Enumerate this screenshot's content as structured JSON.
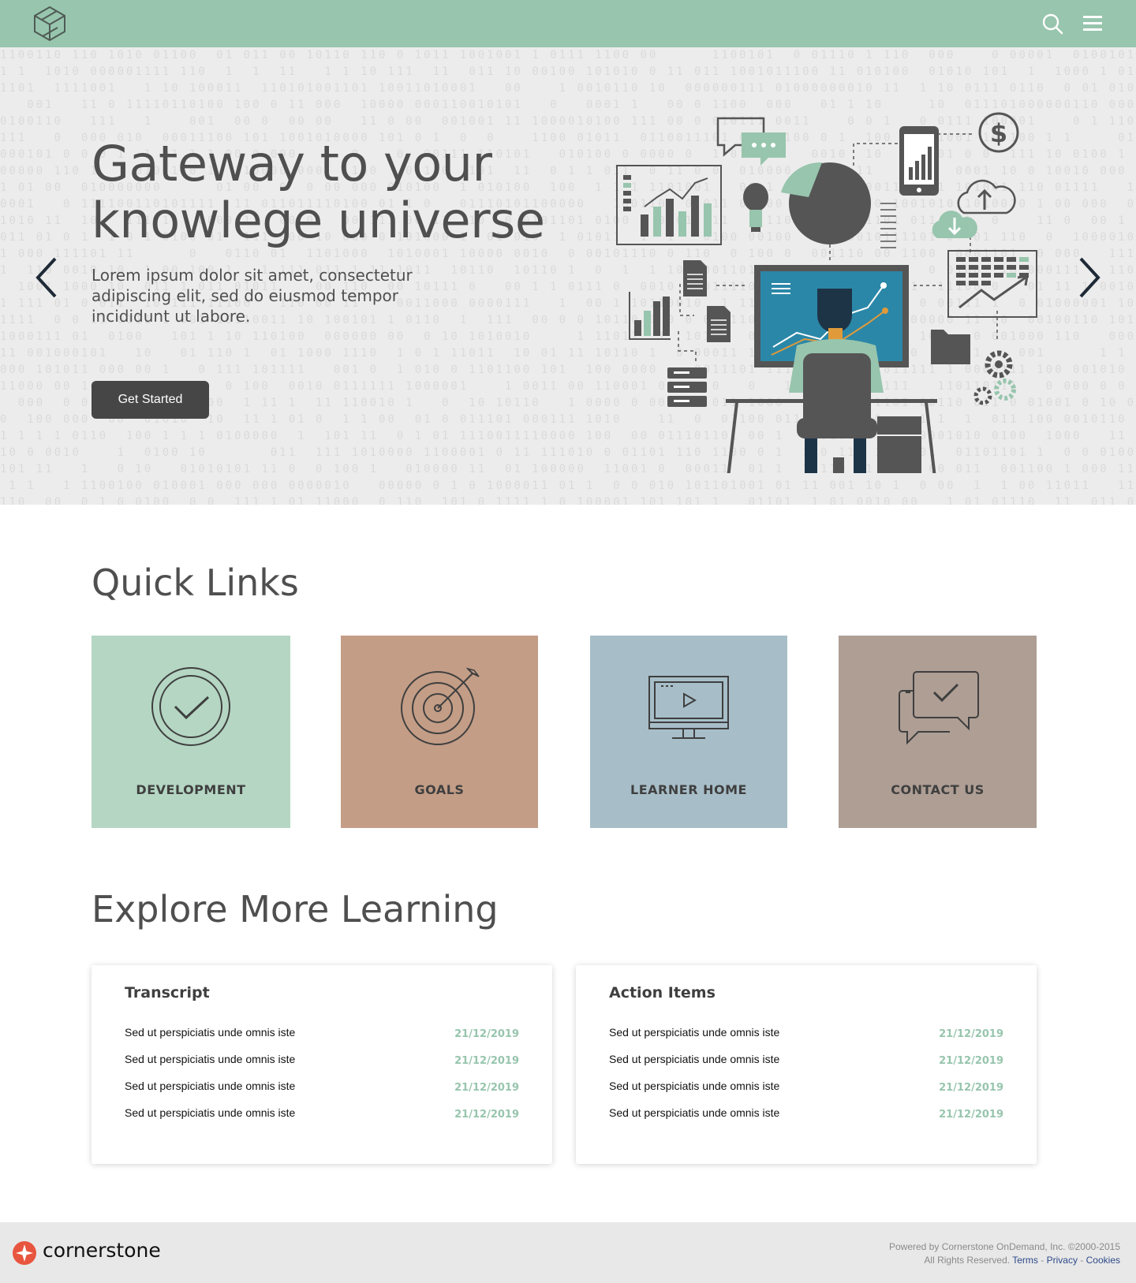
{
  "header": {
    "search_icon": "search-icon",
    "menu_icon": "hamburger-menu-icon",
    "logo": "cube-logo"
  },
  "hero": {
    "title_line1": "Gateway to your",
    "title_line2": "knowlege universe",
    "subtitle": "Lorem ipsum dolor sit amet, consectetur adipiscing elit, sed do eiusmod tempor incididunt ut labore.",
    "cta_label": "Get Started",
    "prev_icon": "chevron-left-icon",
    "next_icon": "chevron-right-icon"
  },
  "quick_links": {
    "title": "Quick Links",
    "items": [
      {
        "label": "DEVELOPMENT",
        "icon": "check-circle-icon",
        "color": "#b4d6c3"
      },
      {
        "label": "GOALS",
        "icon": "target-icon",
        "color": "#c39d86"
      },
      {
        "label": "LEARNER HOME",
        "icon": "monitor-play-icon",
        "color": "#a7bec8"
      },
      {
        "label": "CONTACT US",
        "icon": "chat-bubbles-icon",
        "color": "#ae9e94"
      }
    ]
  },
  "explore": {
    "title": "Explore More Learning",
    "cards": [
      {
        "title": "Transcript",
        "rows": [
          {
            "text": "Sed ut perspiciatis unde omnis iste",
            "date": "21/12/2019"
          },
          {
            "text": "Sed ut perspiciatis unde omnis iste",
            "date": "21/12/2019"
          },
          {
            "text": "Sed ut perspiciatis unde omnis iste",
            "date": "21/12/2019"
          },
          {
            "text": "Sed ut perspiciatis unde omnis iste",
            "date": "21/12/2019"
          }
        ]
      },
      {
        "title": "Action Items",
        "rows": [
          {
            "text": "Sed ut perspiciatis unde omnis iste",
            "date": "21/12/2019"
          },
          {
            "text": "Sed ut perspiciatis unde omnis iste",
            "date": "21/12/2019"
          },
          {
            "text": "Sed ut perspiciatis unde omnis iste",
            "date": "21/12/2019"
          },
          {
            "text": "Sed ut perspiciatis unde omnis iste",
            "date": "21/12/2019"
          }
        ]
      }
    ]
  },
  "footer": {
    "brand": "cornerstone",
    "powered_by": "Powered by Cornerstone OnDemand, Inc. ©2000-2015",
    "rights": "All Rights Reserved.",
    "link_terms": "Terms",
    "link_privacy": "Privacy",
    "link_cookies": "Cookies",
    "separator": "-"
  },
  "colors": {
    "accent": "#97c5ad",
    "dark": "#464646",
    "link": "#2e4a8a"
  }
}
